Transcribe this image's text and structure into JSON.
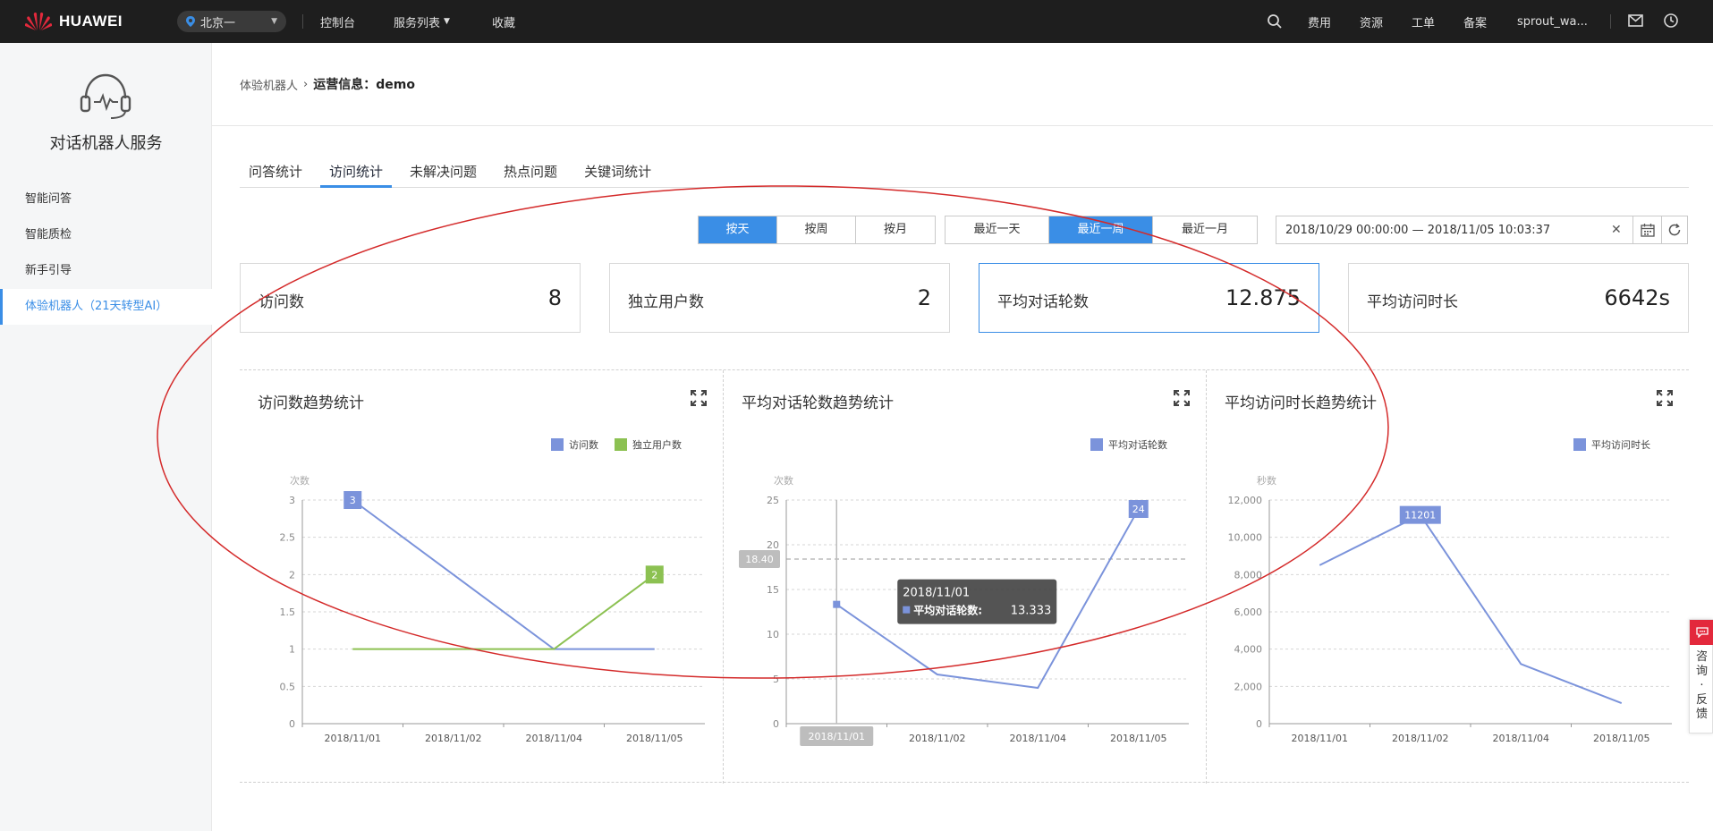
{
  "topbar": {
    "brand": "HUAWEI",
    "region": "北京一",
    "nav": [
      "控制台",
      "服务列表",
      "收藏"
    ],
    "right": [
      "费用",
      "资源",
      "工单",
      "备案",
      "sprout_wa..."
    ],
    "colors": {
      "bg": "#1e1e1e",
      "logo": "#e3293c"
    }
  },
  "sidebar": {
    "service_title": "对话机器人服务",
    "items": [
      {
        "label": "智能问答"
      },
      {
        "label": "智能质检"
      },
      {
        "label": "新手引导"
      },
      {
        "label": "体验机器人（21天转型AI）",
        "active": true
      }
    ]
  },
  "breadcrumb": {
    "parent": "体验机器人",
    "current": "运营信息：demo"
  },
  "tabs": [
    {
      "label": "问答统计"
    },
    {
      "label": "访问统计",
      "active": true
    },
    {
      "label": "未解决问题"
    },
    {
      "label": "热点问题"
    },
    {
      "label": "关键词统计"
    }
  ],
  "granularity": {
    "options": [
      "按天",
      "按周",
      "按月"
    ],
    "selected": "按天"
  },
  "period": {
    "options": [
      "最近一天",
      "最近一周",
      "最近一月"
    ],
    "selected": "最近一周"
  },
  "date_range": "2018/10/29 00:00:00 — 2018/11/05 10:03:37",
  "cards": [
    {
      "label": "访问数",
      "value": "8"
    },
    {
      "label": "独立用户数",
      "value": "2"
    },
    {
      "label": "平均对话轮数",
      "value": "12.875",
      "selected": true
    },
    {
      "label": "平均访问时长",
      "value": "6642s"
    }
  ],
  "accent": "#3a8ee6",
  "chart_data": [
    {
      "type": "line",
      "title": "访问数趋势统计",
      "ylabel": "次数",
      "categories": [
        "2018/11/01",
        "2018/11/02",
        "2018/11/04",
        "2018/11/05"
      ],
      "yticks": [
        "0",
        "0.5",
        "1",
        "1.5",
        "2",
        "2.5",
        "3"
      ],
      "ylim": [
        0,
        3
      ],
      "series": [
        {
          "name": "访问数",
          "color": "#7b93db",
          "points": [
            [
              0,
              3
            ],
            [
              2,
              1
            ],
            [
              3,
              1
            ]
          ]
        },
        {
          "name": "独立用户数",
          "color": "#8cc152",
          "points": [
            [
              0,
              1
            ],
            [
              2,
              1
            ],
            [
              3,
              2
            ]
          ]
        }
      ],
      "markers": [
        {
          "label": "3",
          "x": 0,
          "y": 3,
          "color": "#7b93db"
        },
        {
          "label": "2",
          "x": 3,
          "y": 2,
          "color": "#8cc152"
        }
      ]
    },
    {
      "type": "line",
      "title": "平均对话轮数趋势统计",
      "ylabel": "次数",
      "categories": [
        "2018/11/01",
        "2018/11/02",
        "2018/11/04",
        "2018/11/05"
      ],
      "yticks": [
        "0",
        "5",
        "10",
        "15",
        "20",
        "25"
      ],
      "ylim": [
        0,
        25
      ],
      "series": [
        {
          "name": "平均对话轮数",
          "color": "#7b93db",
          "points": [
            [
              0,
              13.333
            ],
            [
              1,
              5.5
            ],
            [
              2,
              4
            ],
            [
              3,
              24
            ]
          ]
        }
      ],
      "markers": [
        {
          "label": "24",
          "x": 3,
          "y": 24,
          "color": "#7b93db"
        }
      ],
      "average_line": {
        "value": 18.4,
        "label": "18.40"
      },
      "cursor": {
        "x": 0,
        "label": "2018/11/01"
      },
      "tooltip": {
        "title": "2018/11/01",
        "series": "平均对话轮数:",
        "value": "13.333"
      }
    },
    {
      "type": "line",
      "title": "平均访问时长趋势统计",
      "ylabel": "秒数",
      "categories": [
        "2018/11/01",
        "2018/11/02",
        "2018/11/04",
        "2018/11/05"
      ],
      "yticks": [
        "0",
        "2,000",
        "4,000",
        "6,000",
        "8,000",
        "10,000",
        "12,000"
      ],
      "ylim": [
        0,
        12000
      ],
      "series": [
        {
          "name": "平均访问时长",
          "color": "#7b93db",
          "points": [
            [
              0,
              8500
            ],
            [
              1,
              11201
            ],
            [
              2,
              3200
            ],
            [
              3,
              1100
            ]
          ]
        }
      ],
      "markers": [
        {
          "label": "11201",
          "x": 1,
          "y": 11201,
          "color": "#7b93db"
        }
      ]
    }
  ],
  "float_panel": {
    "label": "咨询·反馈"
  }
}
